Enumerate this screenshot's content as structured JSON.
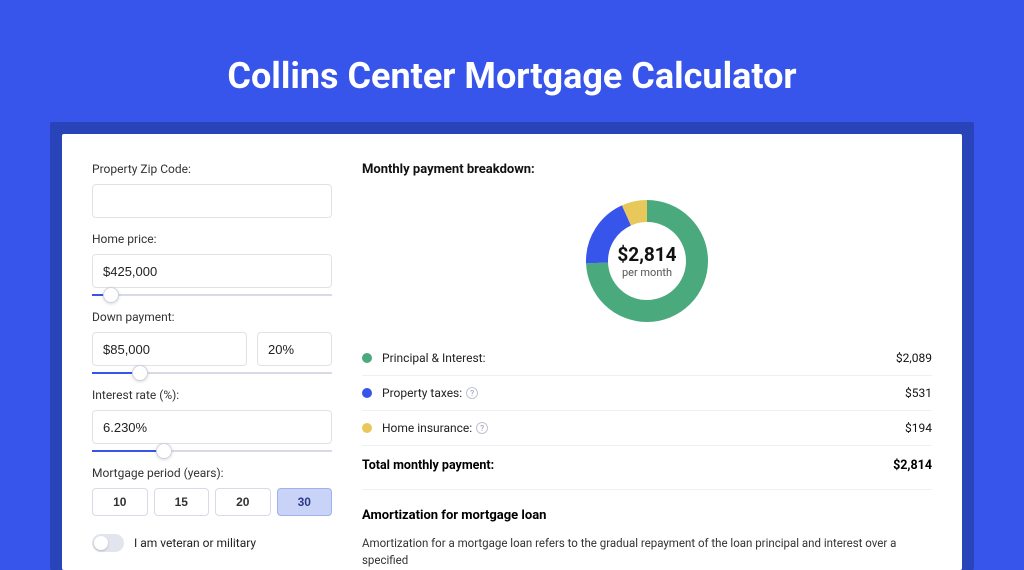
{
  "title": "Collins Center Mortgage Calculator",
  "form": {
    "zip": {
      "label": "Property Zip Code:",
      "value": ""
    },
    "home": {
      "label": "Home price:",
      "value": "$425,000",
      "slider_pct": 8
    },
    "down": {
      "label": "Down payment:",
      "value": "$85,000",
      "pct": "20%",
      "slider_pct": 20
    },
    "rate": {
      "label": "Interest rate (%):",
      "value": "6.230%",
      "slider_pct": 30
    },
    "period": {
      "label": "Mortgage period (years):",
      "options": [
        "10",
        "15",
        "20",
        "30"
      ],
      "selected": "30"
    },
    "veteran": {
      "label": "I am veteran or military",
      "checked": false
    }
  },
  "breakdown": {
    "title": "Monthly payment breakdown:",
    "center_amount": "$2,814",
    "center_sub": "per month",
    "items": [
      {
        "label": "Principal & Interest:",
        "value": "$2,089",
        "color": "green",
        "info": false
      },
      {
        "label": "Property taxes:",
        "value": "$531",
        "color": "blue",
        "info": true
      },
      {
        "label": "Home insurance:",
        "value": "$194",
        "color": "yellow",
        "info": true
      }
    ],
    "total_label": "Total monthly payment:",
    "total_value": "$2,814"
  },
  "amort": {
    "title": "Amortization for mortgage loan",
    "text": "Amortization for a mortgage loan refers to the gradual repayment of the loan principal and interest over a specified"
  },
  "chart_data": {
    "type": "pie",
    "title": "Monthly payment breakdown",
    "series": [
      {
        "name": "Principal & Interest",
        "value": 2089,
        "color": "#4aa97d"
      },
      {
        "name": "Property taxes",
        "value": 531,
        "color": "#3755eb"
      },
      {
        "name": "Home insurance",
        "value": 194,
        "color": "#e9c85b"
      }
    ],
    "total": 2814,
    "center_label": "$2,814 per month"
  }
}
